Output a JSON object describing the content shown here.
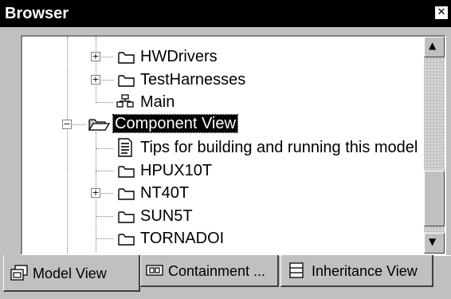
{
  "window": {
    "title": "Browser",
    "close_glyph": "✕"
  },
  "tree": {
    "nodes": [
      {
        "label": "HWDrivers",
        "icon": "folder-icon",
        "expander": "+"
      },
      {
        "label": "TestHarnesses",
        "icon": "folder-icon",
        "expander": "+"
      },
      {
        "label": "Main",
        "icon": "class-diagram-icon",
        "expander": ""
      },
      {
        "label": "Component View",
        "icon": "open-folder-icon",
        "expander": "−",
        "selected": true
      },
      {
        "label": "Tips for building and running this model",
        "icon": "note-document-icon",
        "expander": ""
      },
      {
        "label": "HPUX10T",
        "icon": "folder-icon",
        "expander": ""
      },
      {
        "label": "NT40T",
        "icon": "folder-icon",
        "expander": "+"
      },
      {
        "label": "SUN5T",
        "icon": "folder-icon",
        "expander": ""
      },
      {
        "label": "TORNADOI",
        "icon": "folder-icon",
        "expander": ""
      }
    ]
  },
  "scrollbar": {
    "up_glyph": "▲",
    "down_glyph": "▼"
  },
  "tabs": [
    {
      "label": "Model View",
      "icon": "model-view-icon",
      "active": true
    },
    {
      "label": "Containment ...",
      "icon": "containment-icon",
      "active": false
    },
    {
      "label": "Inheritance View",
      "icon": "inheritance-icon",
      "active": false
    }
  ]
}
